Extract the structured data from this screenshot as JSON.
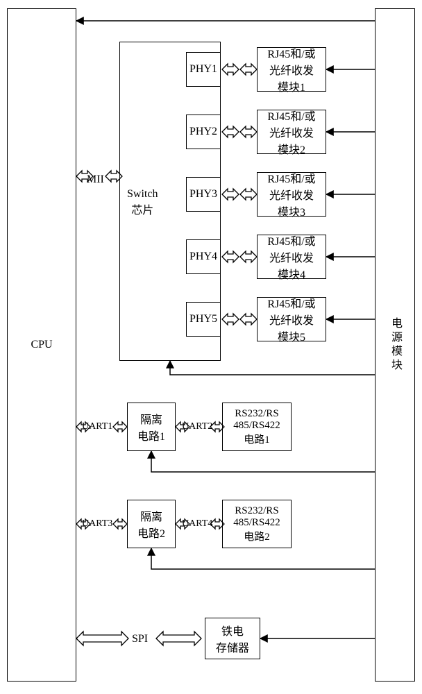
{
  "cpu": "CPU",
  "power": "电源模块",
  "mii": "MII",
  "switch_label": "Switch\n芯片",
  "phy": [
    "PHY1",
    "PHY2",
    "PHY3",
    "PHY4",
    "PHY5"
  ],
  "rj45": [
    "RJ45和/或\n光纤收发\n模块1",
    "RJ45和/或\n光纤收发\n模块2",
    "RJ45和/或\n光纤收发\n模块3",
    "RJ45和/或\n光纤收发\n模块4",
    "RJ45和/或\n光纤收发\n模块5"
  ],
  "uart": [
    "UART1",
    "UART2",
    "UART3",
    "UART4"
  ],
  "iso": [
    "隔离\n电路1",
    "隔离\n电路2"
  ],
  "rs": [
    "RS232/RS\n485/RS422\n电路1",
    "RS232/RS\n485/RS422\n电路2"
  ],
  "spi": "SPI",
  "fram": "铁电\n存储器"
}
